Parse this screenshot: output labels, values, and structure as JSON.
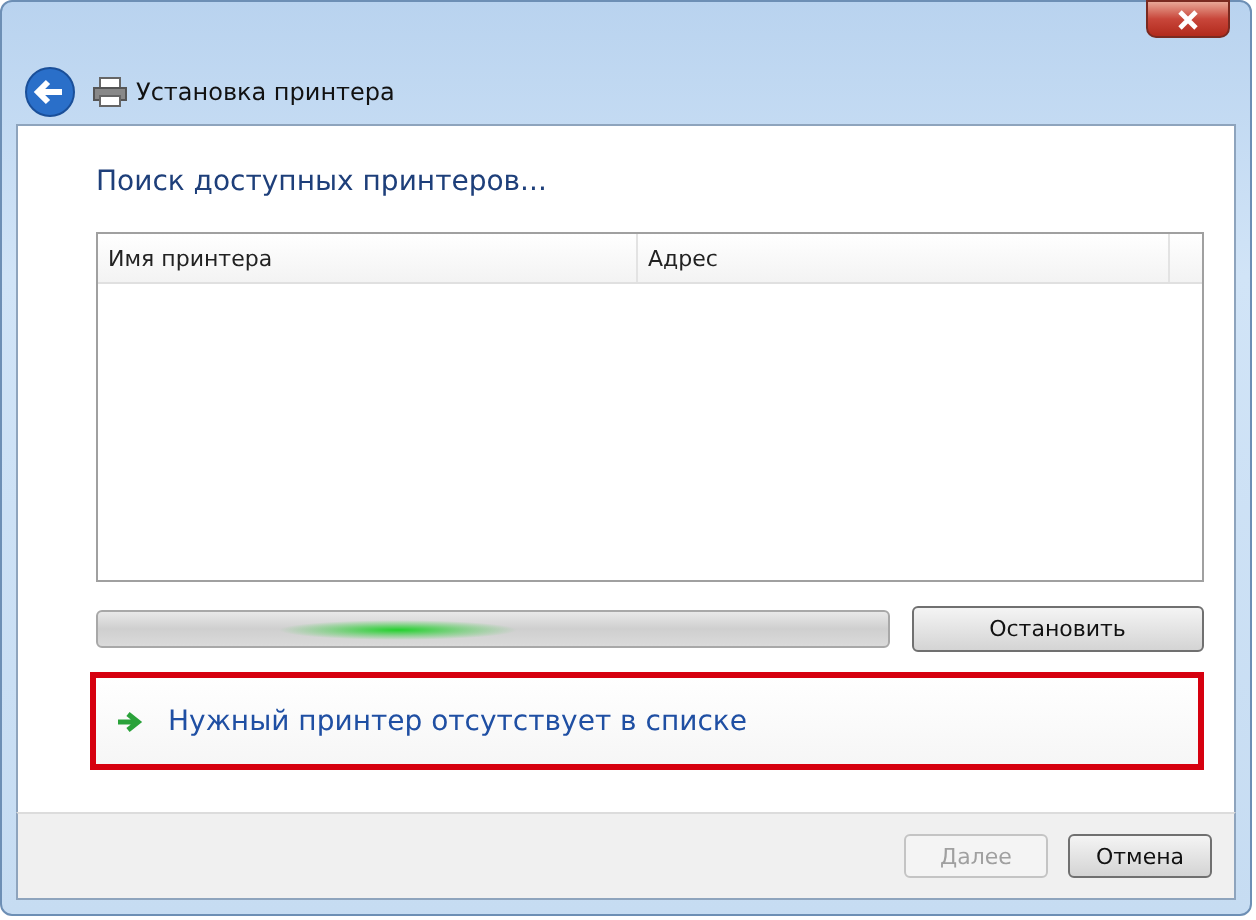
{
  "window": {
    "title": "Установка принтера"
  },
  "heading": "Поиск доступных принтеров...",
  "table": {
    "columns": [
      "Имя принтера",
      "Адрес"
    ]
  },
  "progress": {
    "running": true
  },
  "stop_button": {
    "label": "Остановить",
    "disabled": false
  },
  "link": {
    "label": "Нужный принтер отсутствует в списке",
    "highlighted": true
  },
  "buttons": [
    {
      "label": "Далее",
      "disabled": true
    },
    {
      "label": "Отмена",
      "disabled": false
    }
  ]
}
